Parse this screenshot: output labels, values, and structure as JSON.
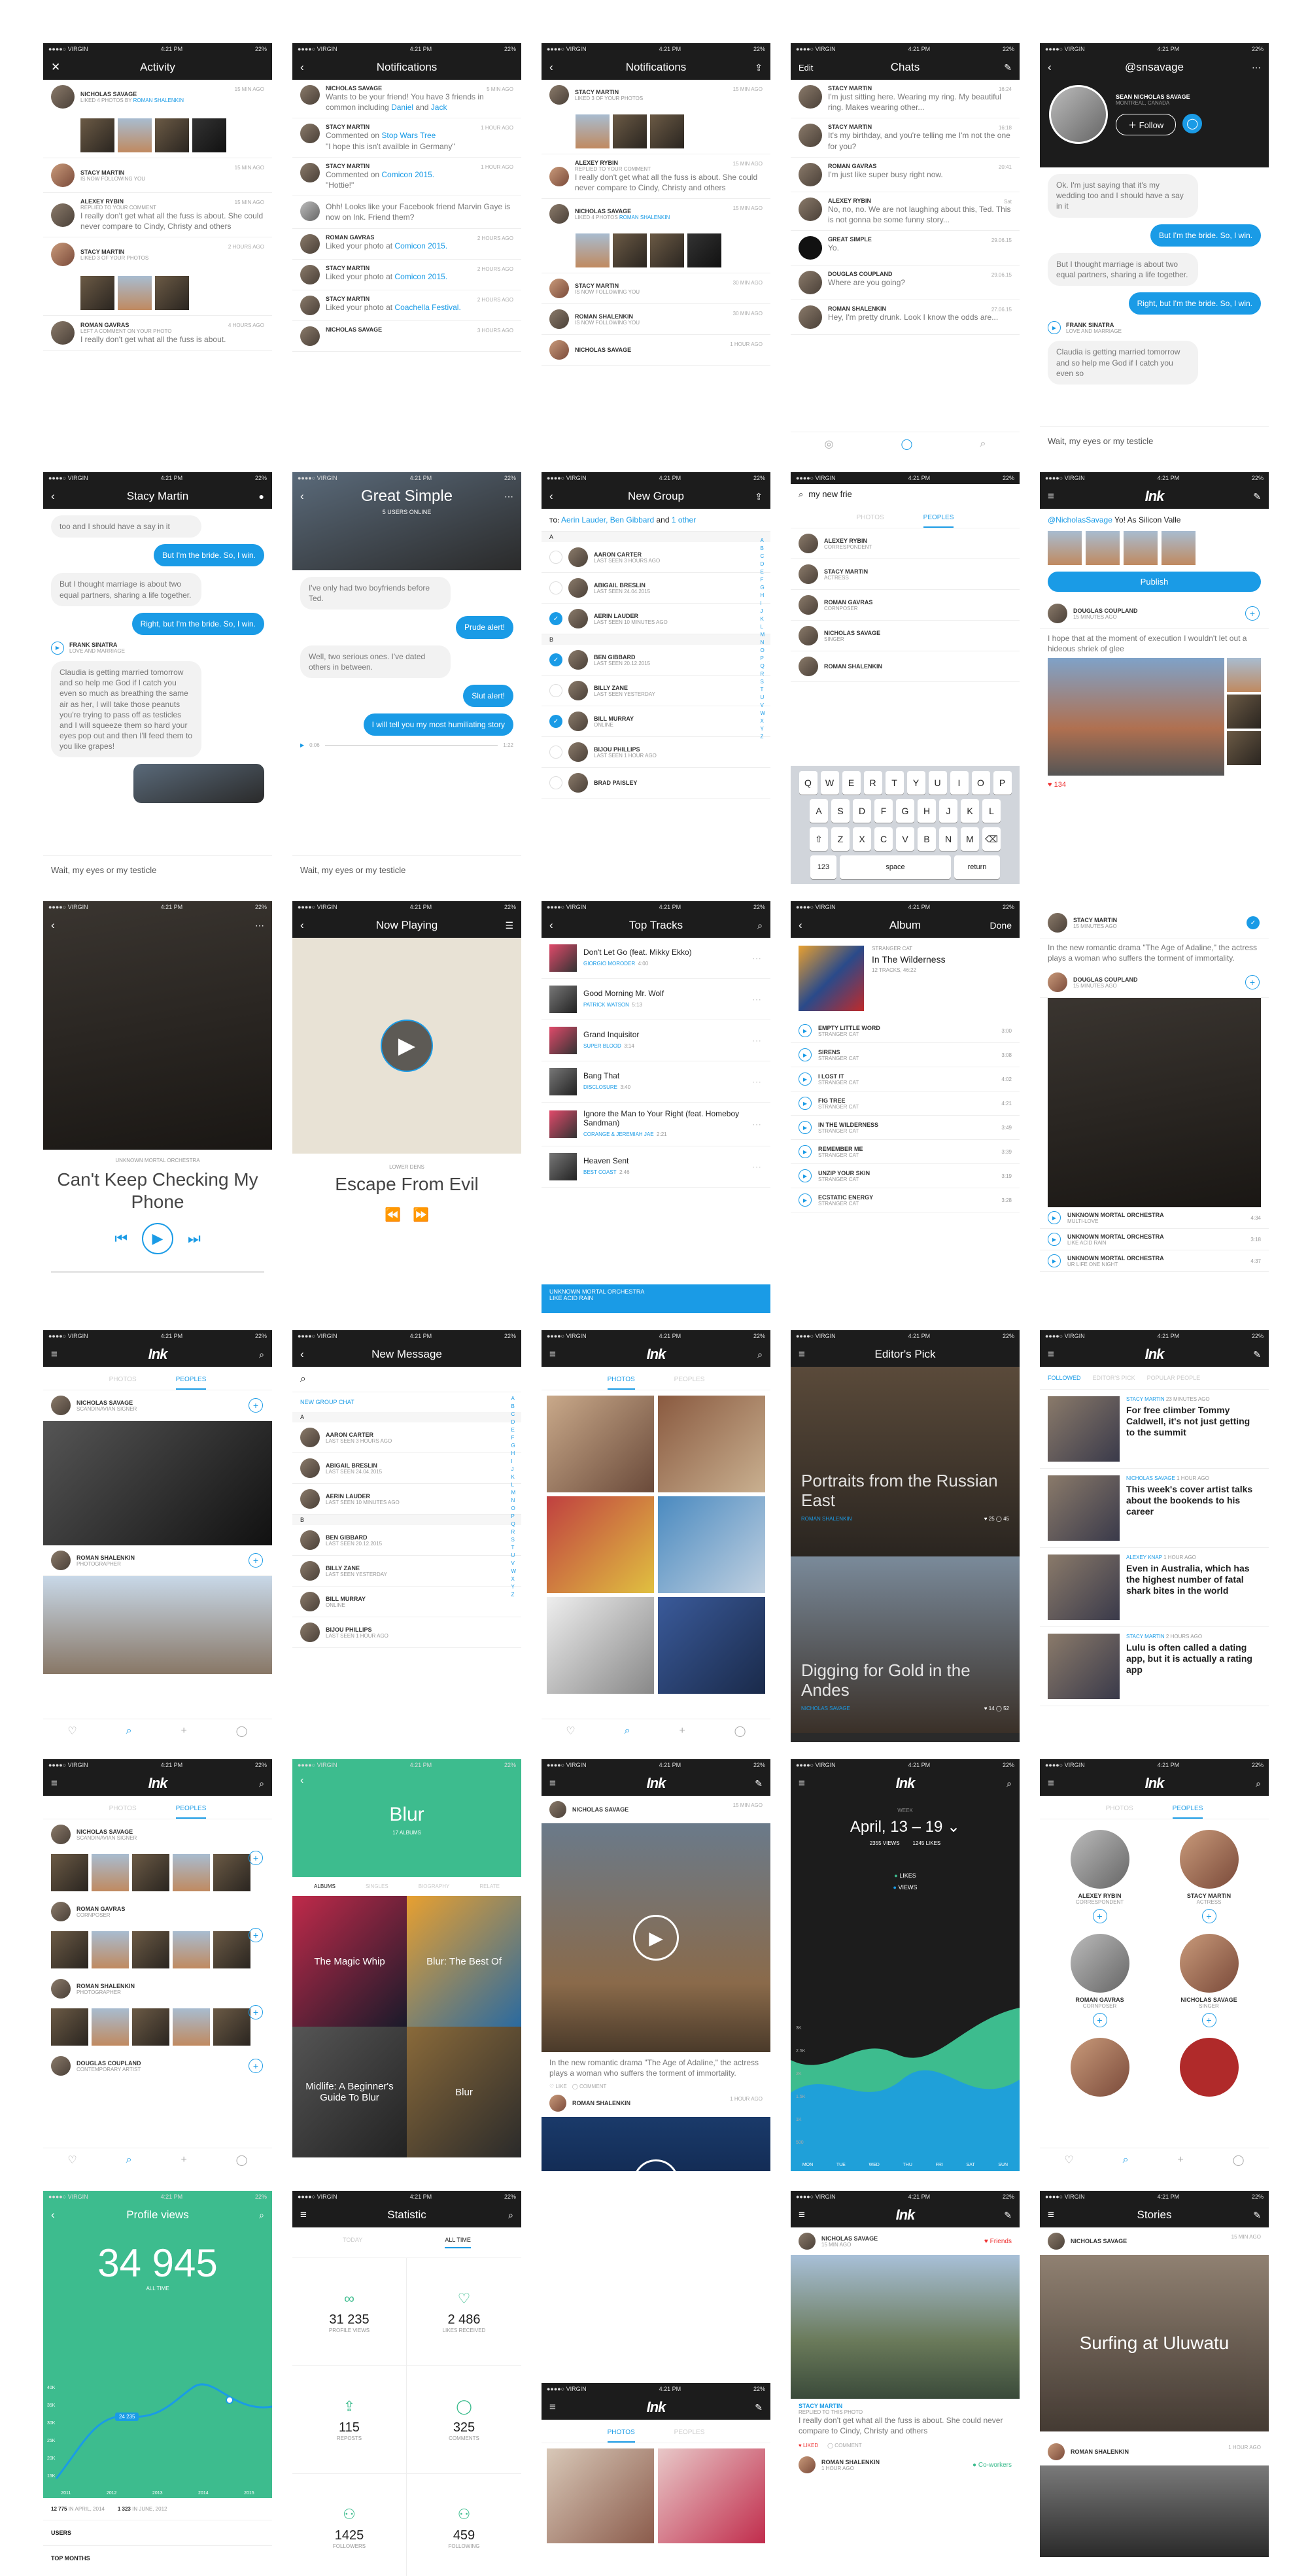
{
  "status": {
    "carrier": "●●●●○ VIRGIN",
    "time": "4:21 PM",
    "battery": "22%"
  },
  "activity": {
    "title": "Activity",
    "items": [
      {
        "name": "NICHOLAS SAVAGE",
        "action": "LIKED 4 PHOTOS BY",
        "target": "ROMAN SHALENKIN",
        "time": "15 MIN AGO"
      },
      {
        "name": "STACY MARTIN",
        "action": "IS NOW FOLLOWING YOU",
        "time": "15 MIN AGO"
      },
      {
        "name": "ALEXEY RYBIN",
        "action": "REPLIED TO YOUR COMMENT",
        "text": "I really don't get what all the fuss is about. She could never compare to Cindy, Christy and others",
        "time": "15 MIN AGO"
      },
      {
        "name": "STACY MARTIN",
        "action": "LIKED 3 OF YOUR PHOTOS",
        "time": "2 HOURS AGO"
      },
      {
        "name": "ROMAN GAVRAS",
        "action": "LEFT A COMMENT ON YOUR PHOTO",
        "text": "I really don't get what all the fuss is about.",
        "time": "4 HOURS AGO"
      }
    ]
  },
  "notifications": {
    "title": "Notifications",
    "items": [
      {
        "name": "NICHOLAS SAVAGE",
        "time": "5 MIN AGO",
        "pre": "Wants to be your friend! You have 3 friends in common including ",
        "l1": "Daniel",
        "mid": " and ",
        "l2": "Jack"
      },
      {
        "name": "STACY MARTIN",
        "time": "1 HOUR AGO",
        "pre": "Commented on ",
        "l1": "Stop Wars Tree",
        "q": "\"I hope this isn't availble in Germany\""
      },
      {
        "name": "STACY MARTIN",
        "time": "1 HOUR AGO",
        "pre": "Commented on ",
        "l1": "Comicon 2015.",
        "q": "\"Hottie!\""
      },
      {
        "name": "",
        "time": "",
        "pre": "Ohh! Looks like your Facebook friend Marvin Gaye is now on Ink. Friend them?"
      },
      {
        "name": "ROMAN GAVRAS",
        "time": "2 HOURS AGO",
        "pre": "Liked your photo at ",
        "l1": "Comicon 2015."
      },
      {
        "name": "STACY MARTIN",
        "time": "2 HOURS AGO",
        "pre": "Liked your photo at ",
        "l1": "Comicon 2015."
      },
      {
        "name": "STACY MARTIN",
        "time": "2 HOURS AGO",
        "pre": "Liked your photo at ",
        "l1": "Coachella Festival."
      },
      {
        "name": "NICHOLAS SAVAGE",
        "time": "3 HOURS AGO",
        "pre": ""
      }
    ]
  },
  "notifications2": {
    "title": "Notifications",
    "items": [
      {
        "name": "STACY MARTIN",
        "sub": "LIKED 3 OF YOUR PHOTOS",
        "time": "15 MIN AGO"
      },
      {
        "name": "ALEXEY RYBIN",
        "sub": "REPLIED TO YOUR COMMENT",
        "text": "I really don't get what all the fuss is about. She could never compare to Cindy, Christy and others",
        "time": "15 MIN AGO"
      },
      {
        "name": "NICHOLAS SAVAGE",
        "sub": "LIKED 4 PHOTOS",
        "target": "ROMAN SHALENKIN",
        "time": "15 MIN AGO"
      },
      {
        "name": "STACY MARTIN",
        "sub": "IS NOW FOLLOWING YOU",
        "time": "30 MIN AGO"
      },
      {
        "name": "ROMAN SHALENKIN",
        "sub": "IS NOW FOLLOWING YOU",
        "time": "30 MIN AGO"
      },
      {
        "name": "NICHOLAS SAVAGE",
        "sub": "",
        "time": "1 HOUR AGO"
      }
    ]
  },
  "chats": {
    "title": "Chats",
    "edit": "Edit",
    "items": [
      {
        "name": "STACY MARTIN",
        "time": "16:24",
        "text": "I'm just sitting here. Wearing my ring. My beautiful ring. Makes wearing other..."
      },
      {
        "name": "STACY MARTIN",
        "time": "16:18",
        "text": "It's my birthday, and you're telling me I'm not the one for you?"
      },
      {
        "name": "ROMAN GAVRAS",
        "time": "20:41",
        "text": "I'm just like super busy right now."
      },
      {
        "name": "ALEXEY RYBIN",
        "time": "Sat",
        "text": "No, no, no. We are not laughing about this, Ted. This is not gonna be some funny story..."
      },
      {
        "name": "GREAT SIMPLE",
        "time": "29.06.15",
        "text": "Yo."
      },
      {
        "name": "DOUGLAS COUPLAND",
        "time": "29.06.15",
        "text": "Where are you going?"
      },
      {
        "name": "ROMAN SHALENKIN",
        "time": "27.06.15",
        "text": "Hey, I'm pretty drunk. Look I know the odds are..."
      }
    ]
  },
  "profile": {
    "title": "@snsavage",
    "name": "SEAN NICHOLAS SAVAGE",
    "loc": "MONTREAL, CANADA",
    "follow": "Follow",
    "msgs": [
      {
        "side": "i",
        "text": "Ok. I'm just saying that it's my wedding too and I should have a say in it"
      },
      {
        "side": "o",
        "text": "But I'm the bride. So, I win."
      },
      {
        "side": "i",
        "text": "But I thought marriage is about two equal partners, sharing a life together."
      },
      {
        "side": "o",
        "text": "Right, but I'm the bride. So, I win."
      }
    ],
    "share": {
      "name": "FRANK SINATRA",
      "sub": "LOVE AND MARRIAGE"
    },
    "tail": "Claudia is getting married tomorrow and so help me God if I catch you even so",
    "input": "Wait, my eyes or my testicle"
  },
  "stacy": {
    "title": "Stacy Martin",
    "top": "too and I should have a say in it",
    "msgs": [
      {
        "side": "o",
        "text": "But I'm the bride. So, I win."
      },
      {
        "side": "i",
        "text": "But I thought marriage is about two equal partners, sharing a life together."
      },
      {
        "side": "o",
        "text": "Right, but I'm the bride. So, I win."
      }
    ],
    "share": {
      "name": "FRANK SINATRA",
      "sub": "LOVE AND MARRIAGE"
    },
    "long": "Claudia is getting married tomorrow and so help me God if I catch you even so much as breathing the same air as her, I will take those peanuts you're trying to pass off as testicles and I will squeeze them so hard your eyes pop out and then I'll feed them to you like grapes!",
    "input": "Wait, my eyes or my testicle"
  },
  "group": {
    "title": "Great Simple",
    "sub": "5 USERS ONLINE",
    "msgs": [
      {
        "side": "i",
        "text": "I've only had two boyfriends before Ted."
      },
      {
        "side": "o",
        "text": "Prude alert!"
      },
      {
        "side": "i",
        "text": "Well, two serious ones. I've dated others in between."
      },
      {
        "side": "o",
        "text": "Slut alert!"
      },
      {
        "side": "o",
        "text": "I will tell you my most humiliating story"
      }
    ],
    "audio": {
      "start": "0:06",
      "end": "1:22"
    },
    "input": "Wait, my eyes or my testicle"
  },
  "newgroup": {
    "title": "New Group",
    "to": "TO:",
    "names": "Aerin Lauder, Ben Gibbard",
    "and": "and",
    "other": "1 other",
    "items": [
      {
        "h": "A"
      },
      {
        "name": "AARON CARTER",
        "sub": "LAST SEEN 3 HOURS AGO",
        "c": false
      },
      {
        "name": "ABIGAIL BRESLIN",
        "sub": "LAST SEEN 24.04.2015",
        "c": false
      },
      {
        "name": "AERIN LAUDER",
        "sub": "LAST SEEN 10 MINUTES AGO",
        "c": true
      },
      {
        "h": "B"
      },
      {
        "name": "BEN GIBBARD",
        "sub": "LAST SEEN 20.12.2015",
        "c": true
      },
      {
        "name": "BILLY ZANE",
        "sub": "LAST SEEN YESTERDAY",
        "c": false
      },
      {
        "name": "BILL MURRAY",
        "sub": "ONLINE",
        "c": true
      },
      {
        "name": "BIJOU PHILLIPS",
        "sub": "LAST SEEN 1 HOUR AGO",
        "c": false
      },
      {
        "name": "BRAD PAISLEY",
        "sub": "",
        "c": false
      }
    ]
  },
  "search": {
    "query": "my new frie",
    "tab1": "PHOTOS",
    "tab2": "PEOPLES",
    "items": [
      {
        "name": "ALEXEY RYBIN",
        "sub": "CORRESPONDENT"
      },
      {
        "name": "STACY MARTIN",
        "sub": "ACTRESS"
      },
      {
        "name": "ROMAN GAVRAS",
        "sub": "CORNPOSER"
      },
      {
        "name": "NICHOLAS SAVAGE",
        "sub": "SINGER"
      },
      {
        "name": "ROMAN SHALENKIN",
        "sub": ""
      }
    ],
    "keys": [
      [
        "Q",
        "W",
        "E",
        "R",
        "T",
        "Y",
        "U",
        "I",
        "O",
        "P"
      ],
      [
        "A",
        "S",
        "D",
        "F",
        "G",
        "H",
        "J",
        "K",
        "L"
      ],
      [
        "⇧",
        "Z",
        "X",
        "C",
        "V",
        "B",
        "N",
        "M",
        "⌫"
      ]
    ],
    "space": "space",
    "ret": "return",
    "num": "123"
  },
  "compose": {
    "title": "Ink",
    "text": "@NicholasSavage",
    "rest": " Yo! As Silicon Valle",
    "publish": "Publish",
    "post": {
      "name": "DOUGLAS COUPLAND",
      "time": "15 MINUTES AGO",
      "text": "I hope that at the moment of execution I wouldn't let out a hideous shriek of glee",
      "likes": "134"
    }
  },
  "player": {
    "artist": "UNKNOWN MORTAL ORCHESTRA",
    "song": "Can't Keep Checking My Phone",
    "start": "1:26",
    "end": "4:03"
  },
  "nowplaying": {
    "title": "Now Playing",
    "artist": "LOWER DENS",
    "song": "Escape From Evil"
  },
  "toptracks": {
    "title": "Top Tracks",
    "items": [
      {
        "t": "Don't Let Go (feat. Mikky Ekko)",
        "a": "GIORGIO MORODER",
        "d": "4:00"
      },
      {
        "t": "Good Morning Mr. Wolf",
        "a": "PATRICK WATSON",
        "d": "5:13"
      },
      {
        "t": "Grand Inquisitor",
        "a": "SUPER BLOOD",
        "d": "3:14"
      },
      {
        "t": "Bang That",
        "a": "DISCLOSURE",
        "d": "3:40"
      },
      {
        "t": "Ignore the Man to Your Right (feat. Homeboy Sandman)",
        "a": "CORANGE & JEREMIAH JAE",
        "d": "2:21"
      },
      {
        "t": "Heaven Sent",
        "a": "BEST COAST",
        "d": "2:46"
      }
    ],
    "bar": {
      "a": "UNKNOWN MORTAL ORCHESTRA",
      "s": "LIKE ACID RAIN"
    }
  },
  "album": {
    "title": "Album",
    "done": "Done",
    "artist": "STRANGER CAT",
    "name": "In The Wilderness",
    "count": "12 TRACKS, 46:22",
    "tracks": [
      {
        "t": "EMPTY LITTLE WORD",
        "d": "3:00"
      },
      {
        "t": "SIRENS",
        "d": "3:08"
      },
      {
        "t": "I LOST IT",
        "d": "4:02"
      },
      {
        "t": "FIG TREE",
        "d": "4:21"
      },
      {
        "t": "IN THE WILDERNESS",
        "d": "3:49"
      },
      {
        "t": "REMEMBER ME",
        "d": "3:39"
      },
      {
        "t": "UNZIP YOUR SKIN",
        "d": "3:19"
      },
      {
        "t": "ECSTATIC ENERGY",
        "d": "3:28"
      }
    ],
    "sub": "STRANGER CAT"
  },
  "feedmusic": {
    "post": {
      "name": "DOUGLAS COUPLAND",
      "time": "15 MINUTES AGO"
    },
    "tracks": [
      {
        "a": "UNKNOWN MORTAL ORCHESTRA",
        "s": "MULTI-LOVE",
        "d": "4:34"
      },
      {
        "a": "UNKNOWN MORTAL ORCHESTRA",
        "s": "LIKE ACID RAIN",
        "d": "3:18"
      },
      {
        "a": "UNKNOWN MORTAL ORCHESTRA",
        "s": "UR LIFE ONE NIGHT",
        "d": "4:37"
      }
    ],
    "stacy": {
      "name": "STACY MARTIN",
      "time": "15 MINUTES AGO",
      "text": "In the new romantic drama \"The Age of Adaline,\" the actress plays a woman who suffers the torment of immortality."
    }
  },
  "inkpeople": {
    "title": "Ink",
    "tab1": "PHOTOS",
    "tab2": "PEOPLES",
    "p1": {
      "name": "NICHOLAS SAVAGE",
      "sub": "SCANDINAVIAN SIGNER"
    },
    "p2": {
      "name": "ROMAN SHALENKIN",
      "sub": "PHOTOGRAPHER"
    }
  },
  "newmsg": {
    "title": "New Message",
    "group": "NEW GROUP CHAT",
    "items": [
      {
        "h": "A"
      },
      {
        "name": "AARON CARTER",
        "sub": "LAST SEEN 3 HOURS AGO"
      },
      {
        "name": "ABIGAIL BRESLIN",
        "sub": "LAST SEEN 24.04.2015"
      },
      {
        "name": "AERIN LAUDER",
        "sub": "LAST SEEN 10 MINUTES AGO"
      },
      {
        "h": "B"
      },
      {
        "name": "BEN GIBBARD",
        "sub": "LAST SEEN 20.12.2015"
      },
      {
        "name": "BILLY ZANE",
        "sub": "LAST SEEN YESTERDAY"
      },
      {
        "name": "BILL MURRAY",
        "sub": "ONLINE"
      },
      {
        "name": "BIJOU PHILLIPS",
        "sub": "LAST SEEN 1 HOUR AGO"
      }
    ]
  },
  "inkphotos": {
    "title": "Ink",
    "tab1": "PHOTOS",
    "tab2": "PEOPLES"
  },
  "editors": {
    "title": "Editor's Pick",
    "a1": {
      "t": "Portraits from the Russian East",
      "n": "ROMAN SHALENKIN",
      "l": "25",
      "c": "45"
    },
    "a2": {
      "t": "Digging for Gold in the Andes",
      "n": "NICHOLAS SAVAGE",
      "l": "14",
      "c": "52"
    }
  },
  "followed": {
    "title": "Ink",
    "tabs": [
      "FOLLOWED",
      "EDITOR'S PICK",
      "POPULAR PEOPLE"
    ],
    "items": [
      {
        "n": "STACY MARTIN",
        "t": "23 MINUTES AGO",
        "h": "For free climber Tommy Caldwell, it's not just getting to the summit"
      },
      {
        "n": "NICHOLAS SAVAGE",
        "t": "1 HOUR AGO",
        "h": "This week's cover artist talks about the bookends to his career"
      },
      {
        "n": "ALEXEY KNAP",
        "t": "1 HOUR AGO",
        "h": "Even in Australia, which has the highest number of fatal shark bites in the world"
      },
      {
        "n": "STACY MARTIN",
        "t": "2 HOURS AGO",
        "h": "Lulu is often called a dating app, but it is actually a rating app"
      }
    ]
  },
  "peoplelist": {
    "title": "Ink",
    "tab1": "PHOTOS",
    "tab2": "PEOPLES",
    "items": [
      {
        "name": "NICHOLAS SAVAGE",
        "sub": "SCANDINAVIAN SIGNER"
      },
      {
        "name": "ROMAN GAVRAS",
        "sub": "CORNPOSER"
      },
      {
        "name": "ROMAN SHALENKIN",
        "sub": "PHOTOGRAPHER"
      },
      {
        "name": "DOUGLAS COUPLAND",
        "sub": "CONTEMPORARY ARTIST"
      }
    ]
  },
  "blur": {
    "title": "Blur",
    "sub": "17 ALBUMS",
    "tabs": [
      "ALBUMS",
      "SINGLES",
      "BIOGRAPHY",
      "RELATE"
    ],
    "albums": [
      "The Magic Whip",
      "Blur: The Best Of",
      "Midlife: A Beginner's Guide To Blur",
      "Blur"
    ]
  },
  "videofeed": {
    "title": "Ink",
    "p1": {
      "name": "NICHOLAS SAVAGE",
      "time": "15 MIN AGO"
    },
    "text": "In the new romantic drama \"The Age of Adaline,\" the actress plays a woman who suffers the torment of immortality.",
    "like": "LIKE",
    "comment": "COMMENT",
    "p2": {
      "name": "ROMAN SHALENKIN",
      "time": "1 HOUR AGO"
    }
  },
  "stats": {
    "title": "Ink",
    "label": "WEEK",
    "range": "April, 13 – 19",
    "views": "2355 VIEWS",
    "likes": "1245 LIKES",
    "legend": [
      "LIKES",
      "VIEWS"
    ],
    "days": [
      "MON",
      "TUE",
      "WED",
      "THU",
      "FRI",
      "SAT",
      "SUN"
    ],
    "y": [
      "3K",
      "2.5K",
      "2K",
      "1.5K",
      "1K",
      "500"
    ]
  },
  "peoplegrid": {
    "title": "Ink",
    "tab1": "PHOTOS",
    "tab2": "PEOPLES",
    "items": [
      {
        "name": "ALEXEY RYBIN",
        "sub": "CORRESPONDENT"
      },
      {
        "name": "STACY MARTIN",
        "sub": "ACTRESS"
      },
      {
        "name": "ROMAN GAVRAS",
        "sub": "CORNPOSER"
      },
      {
        "name": "NICHOLAS SAVAGE",
        "sub": "SINGER"
      }
    ]
  },
  "profileviews": {
    "title": "Profile views",
    "value": "34 945",
    "label": "ALL TIME",
    "tip": "24 235",
    "years": [
      "2011",
      "2012",
      "2013",
      "2014",
      "2015"
    ],
    "y": [
      "40K",
      "35K",
      "30K",
      "25K",
      "20K",
      "15K"
    ],
    "s1": "12 775",
    "s1l": "IN APRIL, 2014",
    "s2": "1 323",
    "s2l": "IN JUNE, 2012",
    "users": "USERS",
    "months": "TOP MONTHS"
  },
  "statistic": {
    "title": "Statistic",
    "tabs": [
      "TODAY",
      "ALL TIME"
    ],
    "cells": [
      {
        "v": "31 235",
        "l": "PROFILE VIEWS"
      },
      {
        "v": "2 486",
        "l": "LIKES RECEIVED"
      },
      {
        "v": "115",
        "l": "REPOSTS"
      },
      {
        "v": "325",
        "l": "COMMENTS"
      },
      {
        "v": "1425",
        "l": "FOLLOWERS"
      },
      {
        "v": "459",
        "l": "FOLLOWING"
      }
    ]
  },
  "inkphotos2": {
    "title": "Ink",
    "tab1": "PHOTOS",
    "tab2": "PEOPLES"
  },
  "friendsfeed": {
    "title": "Ink",
    "p1": {
      "name": "NICHOLAS SAVAGE",
      "time": "15 MIN AGO",
      "badge": "Friends"
    },
    "reply": {
      "name": "STACY MARTIN",
      "sub": "REPLIED TO THIS PHOTO",
      "text": "I really don't get what all the fuss is about. She could never compare to Cindy, Christy and others"
    },
    "liked": "LIKED",
    "comment": "COMMENT",
    "p2": {
      "name": "ROMAN SHALENKIN",
      "time": "1 HOUR AGO",
      "badge": "Co-workers"
    }
  },
  "stories": {
    "title": "Stories",
    "p1": {
      "name": "NICHOLAS SAVAGE",
      "time": "15 MIN AGO"
    },
    "t1": "Surfing at Uluwatu",
    "p2": {
      "name": "ROMAN SHALENKIN",
      "time": "1 HOUR AGO"
    }
  }
}
